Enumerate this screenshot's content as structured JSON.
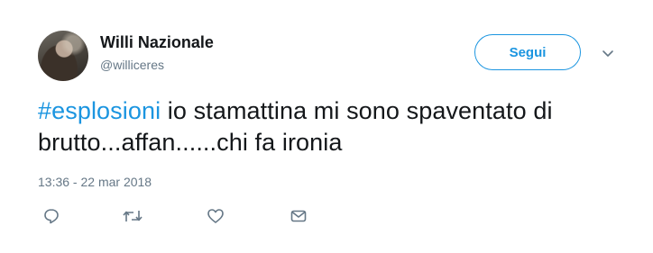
{
  "author": {
    "display_name": "Willi Nazionale",
    "handle": "@williceres"
  },
  "follow_button": {
    "label": "Segui"
  },
  "tweet": {
    "hashtag": "#esplosioni",
    "text_after_hashtag": " io stamattina mi sono spaventato di brutto...affan......chi fa ironia",
    "timestamp": "13:36 - 22 mar 2018"
  },
  "actions": [
    "reply-icon",
    "retweet-icon",
    "like-icon",
    "direct-message-icon"
  ],
  "colors": {
    "accent": "#1b95e0",
    "secondary_text": "#657786",
    "primary_text": "#14171a"
  }
}
